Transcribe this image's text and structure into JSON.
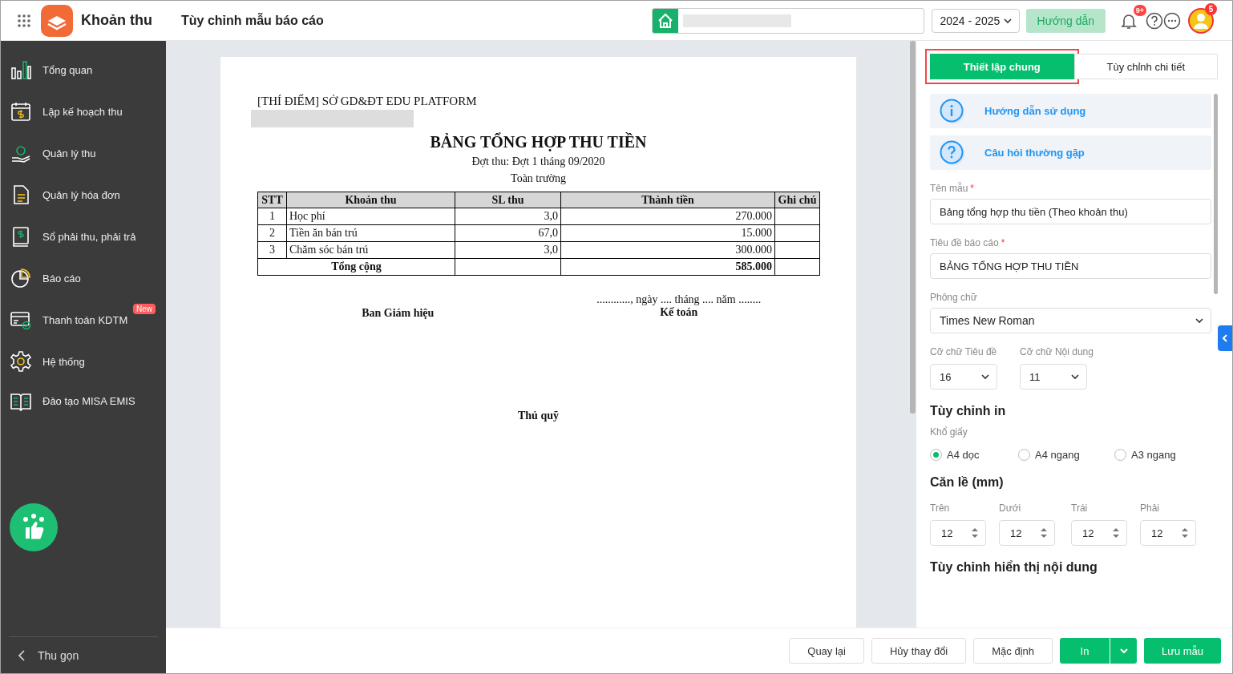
{
  "header": {
    "app_name": "Khoản thu",
    "page_title": "Tùy chỉnh mẫu báo cáo",
    "year_select": "2024 - 2025",
    "guide_button": "Hướng dẫn",
    "notification_badge": "9+",
    "avatar_badge": "5"
  },
  "sidebar": {
    "items": [
      {
        "label": "Tổng quan"
      },
      {
        "label": "Lập kế hoạch thu"
      },
      {
        "label": "Quản lý thu"
      },
      {
        "label": "Quản lý hóa đơn"
      },
      {
        "label": "Sổ phải thu, phải trả"
      },
      {
        "label": "Báo cáo"
      },
      {
        "label": "Thanh toán KDTM",
        "badge": "New"
      },
      {
        "label": "Hệ thống"
      },
      {
        "label": "Đào tạo MISA EMIS"
      }
    ],
    "collapse": "Thu gọn"
  },
  "report": {
    "organization": "[THÍ ĐIỂM] SỞ GD&ĐT EDU PLATFORM",
    "title": "BẢNG TỔNG HỢP THU TIỀN",
    "period": "Đợt thu: Đợt 1 tháng 09/2020",
    "scope": "Toàn trường",
    "columns": [
      "STT",
      "Khoản thu",
      "SL thu",
      "Thành tiền",
      "Ghi chú"
    ],
    "rows": [
      [
        "1",
        "Học phí",
        "3,0",
        "270.000",
        ""
      ],
      [
        "2",
        "Tiền ăn bán trú",
        "67,0",
        "15.000",
        ""
      ],
      [
        "3",
        "Chăm sóc bán trú",
        "3,0",
        "300.000",
        ""
      ]
    ],
    "total": {
      "label": "Tổng cộng",
      "amount": "585.000"
    },
    "date_line": "............, ngày .... tháng .... năm ........",
    "signers": [
      "Ban Giám hiệu",
      "Kế toán",
      "Thủ quỹ"
    ]
  },
  "panel": {
    "tabs": [
      {
        "label": "Thiết lập chung",
        "selected": true
      },
      {
        "label": "Tùy chỉnh chi tiết",
        "selected": false
      }
    ],
    "help_links": [
      {
        "label": "Hướng dẫn sử dụng",
        "kind": "info"
      },
      {
        "label": "Câu hỏi thường gặp",
        "kind": "question"
      }
    ],
    "template_name": {
      "label": "Tên mẫu",
      "mark": "*",
      "value": "Bảng tổng hợp thu tiền (Theo khoản thu)"
    },
    "report_title": {
      "label": "Tiêu đề báo cáo",
      "mark": "*",
      "value": "BẢNG TỔNG HỢP THU TIỀN"
    },
    "font": {
      "label": "Phông chữ",
      "value": "Times New Roman"
    },
    "title_size": {
      "label": "Cỡ chữ Tiêu đề",
      "value": "16"
    },
    "content_size": {
      "label": "Cỡ chữ Nội dung",
      "value": "11"
    },
    "print_heading": "Tùy chỉnh in",
    "paper_label": "Khổ giấy",
    "paper_sizes": [
      {
        "label": "A4 dọc",
        "selected": true
      },
      {
        "label": "A4 ngang",
        "selected": false
      },
      {
        "label": "A3 ngang",
        "selected": false
      }
    ],
    "margin_heading": "Căn lề (mm)",
    "margins": [
      {
        "label": "Trên",
        "value": "12"
      },
      {
        "label": "Dưới",
        "value": "12"
      },
      {
        "label": "Trái",
        "value": "12"
      },
      {
        "label": "Phải",
        "value": "12"
      }
    ],
    "display_heading": "Tùy chỉnh hiển thị nội dung"
  },
  "footer": {
    "back": "Quay lại",
    "discard": "Hủy thay đổi",
    "default": "Mặc định",
    "print": "In",
    "save": "Lưu mẫu"
  }
}
